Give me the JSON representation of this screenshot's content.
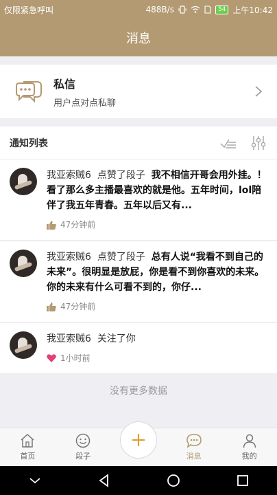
{
  "status_bar": {
    "carrier": "仅限紧急呼叫",
    "net_speed": "488B/s",
    "battery": "54",
    "time": "上午10:42"
  },
  "header": {
    "title": "消息"
  },
  "dm": {
    "title": "私信",
    "subtitle": "用户点对点私聊"
  },
  "list": {
    "title": "通知列表"
  },
  "notifications": [
    {
      "user": "我亚索贼6",
      "action": "点赞了段子",
      "content": "我不相信开哥会用外挂。！ 看了那么多主播最喜欢的就是他。五年时间，lol陪伴了我五年青春。五年以后又有...",
      "time": "47分钟前",
      "icon": "thumbs-up-icon"
    },
    {
      "user": "我亚索贼6",
      "action": "点赞了段子",
      "content": "总有人说“我看不到自己的未来”。很明显是放屁，你是看不到你喜欢的未来。你的未来有什么可看不到的，你仔...",
      "time": "47分钟前",
      "icon": "thumbs-up-icon"
    },
    {
      "user": "我亚索贼6",
      "action": "关注了你",
      "content": "",
      "time": "1小时前",
      "icon": "heart-icon"
    }
  ],
  "footer_text": "没有更多数据",
  "tabs": [
    {
      "label": "首页",
      "icon": "home-icon"
    },
    {
      "label": "段子",
      "icon": "smile-icon"
    },
    {
      "label": "消息",
      "icon": "chat-icon",
      "active": true
    },
    {
      "label": "我的",
      "icon": "user-icon"
    }
  ],
  "colors": {
    "brand": "#b39a72",
    "like": "#b39a72",
    "heart": "#e2407a"
  }
}
